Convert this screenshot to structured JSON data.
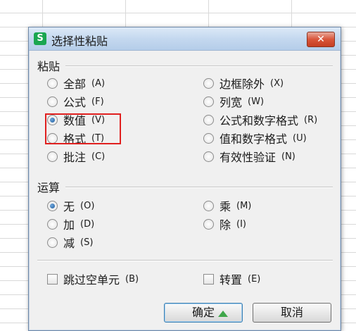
{
  "dialog": {
    "app_icon": "S",
    "title": "选择性粘贴",
    "close_label": "✕"
  },
  "paste_group": {
    "label": "粘贴",
    "options_left": [
      {
        "label": "全部",
        "shortcut": "(A)",
        "checked": false
      },
      {
        "label": "公式",
        "shortcut": "(F)",
        "checked": false
      },
      {
        "label": "数值",
        "shortcut": "(V)",
        "checked": true
      },
      {
        "label": "格式",
        "shortcut": "(T)",
        "checked": false
      },
      {
        "label": "批注",
        "shortcut": "(C)",
        "checked": false
      }
    ],
    "options_right": [
      {
        "label": "边框除外",
        "shortcut": "(X)",
        "checked": false
      },
      {
        "label": "列宽",
        "shortcut": "(W)",
        "checked": false
      },
      {
        "label": "公式和数字格式",
        "shortcut": "(R)",
        "checked": false
      },
      {
        "label": "值和数字格式",
        "shortcut": "(U)",
        "checked": false
      },
      {
        "label": "有效性验证",
        "shortcut": "(N)",
        "checked": false
      }
    ]
  },
  "operation_group": {
    "label": "运算",
    "options_left": [
      {
        "label": "无",
        "shortcut": "(O)",
        "checked": true
      },
      {
        "label": "加",
        "shortcut": "(D)",
        "checked": false
      },
      {
        "label": "减",
        "shortcut": "(S)",
        "checked": false
      }
    ],
    "options_right": [
      {
        "label": "乘",
        "shortcut": "(M)",
        "checked": false
      },
      {
        "label": "除",
        "shortcut": "(I)",
        "checked": false
      }
    ]
  },
  "checkboxes": {
    "skip_blanks": {
      "label": "跳过空单元",
      "shortcut": "(B)",
      "checked": false
    },
    "transpose": {
      "label": "转置",
      "shortcut": "(E)",
      "checked": false
    }
  },
  "buttons": {
    "ok": "确定",
    "cancel": "取消"
  }
}
